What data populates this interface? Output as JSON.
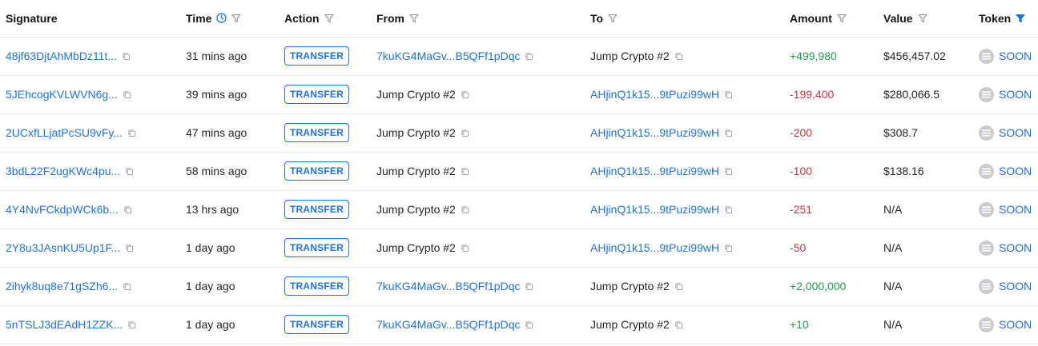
{
  "columns": {
    "signature": "Signature",
    "time": "Time",
    "action": "Action",
    "from": "From",
    "to": "To",
    "amount": "Amount",
    "value": "Value",
    "token": "Token"
  },
  "colors": {
    "link": "#1b73e8",
    "positive": "#1e9e49",
    "negative": "#d0353f",
    "active_filter": "#1b73e8"
  },
  "rows": [
    {
      "signature": "48jf63DjtAhMbDz11t...",
      "time": "31 mins ago",
      "action": "TRANSFER",
      "from": "7kuKG4MaGv...B5QFf1pDqc",
      "from_link": true,
      "to": "Jump Crypto #2",
      "to_link": false,
      "amount": "+499,980",
      "amount_sign": "pos",
      "value": "$456,457.02",
      "token": "SOON"
    },
    {
      "signature": "5JEhcogKVLWVN6g...",
      "time": "39 mins ago",
      "action": "TRANSFER",
      "from": "Jump Crypto #2",
      "from_link": false,
      "to": "AHjinQ1k15...9tPuzi99wH",
      "to_link": true,
      "amount": "-199,400",
      "amount_sign": "neg",
      "value": "$280,066.5",
      "token": "SOON"
    },
    {
      "signature": "2UCxfLLjatPcSU9vFy...",
      "time": "47 mins ago",
      "action": "TRANSFER",
      "from": "Jump Crypto #2",
      "from_link": false,
      "to": "AHjinQ1k15...9tPuzi99wH",
      "to_link": true,
      "amount": "-200",
      "amount_sign": "neg",
      "value": "$308.7",
      "token": "SOON"
    },
    {
      "signature": "3bdL22F2ugKWc4pu...",
      "time": "58 mins ago",
      "action": "TRANSFER",
      "from": "Jump Crypto #2",
      "from_link": false,
      "to": "AHjinQ1k15...9tPuzi99wH",
      "to_link": true,
      "amount": "-100",
      "amount_sign": "neg",
      "value": "$138.16",
      "token": "SOON"
    },
    {
      "signature": "4Y4NvFCkdpWCk6b...",
      "time": "13 hrs ago",
      "action": "TRANSFER",
      "from": "Jump Crypto #2",
      "from_link": false,
      "to": "AHjinQ1k15...9tPuzi99wH",
      "to_link": true,
      "amount": "-251",
      "amount_sign": "neg",
      "value": "N/A",
      "token": "SOON"
    },
    {
      "signature": "2Y8u3JAsnKU5Up1F...",
      "time": "1 day ago",
      "action": "TRANSFER",
      "from": "Jump Crypto #2",
      "from_link": false,
      "to": "AHjinQ1k15...9tPuzi99wH",
      "to_link": true,
      "amount": "-50",
      "amount_sign": "neg",
      "value": "N/A",
      "token": "SOON"
    },
    {
      "signature": "2ihyk8uq8e71gSZh6...",
      "time": "1 day ago",
      "action": "TRANSFER",
      "from": "7kuKG4MaGv...B5QFf1pDqc",
      "from_link": true,
      "to": "Jump Crypto #2",
      "to_link": false,
      "amount": "+2,000,000",
      "amount_sign": "pos",
      "value": "N/A",
      "token": "SOON"
    },
    {
      "signature": "5nTSLJ3dEAdH1ZZK...",
      "time": "1 day ago",
      "action": "TRANSFER",
      "from": "7kuKG4MaGv...B5QFf1pDqc",
      "from_link": true,
      "to": "Jump Crypto #2",
      "to_link": false,
      "amount": "+10",
      "amount_sign": "pos",
      "value": "N/A",
      "token": "SOON"
    }
  ]
}
